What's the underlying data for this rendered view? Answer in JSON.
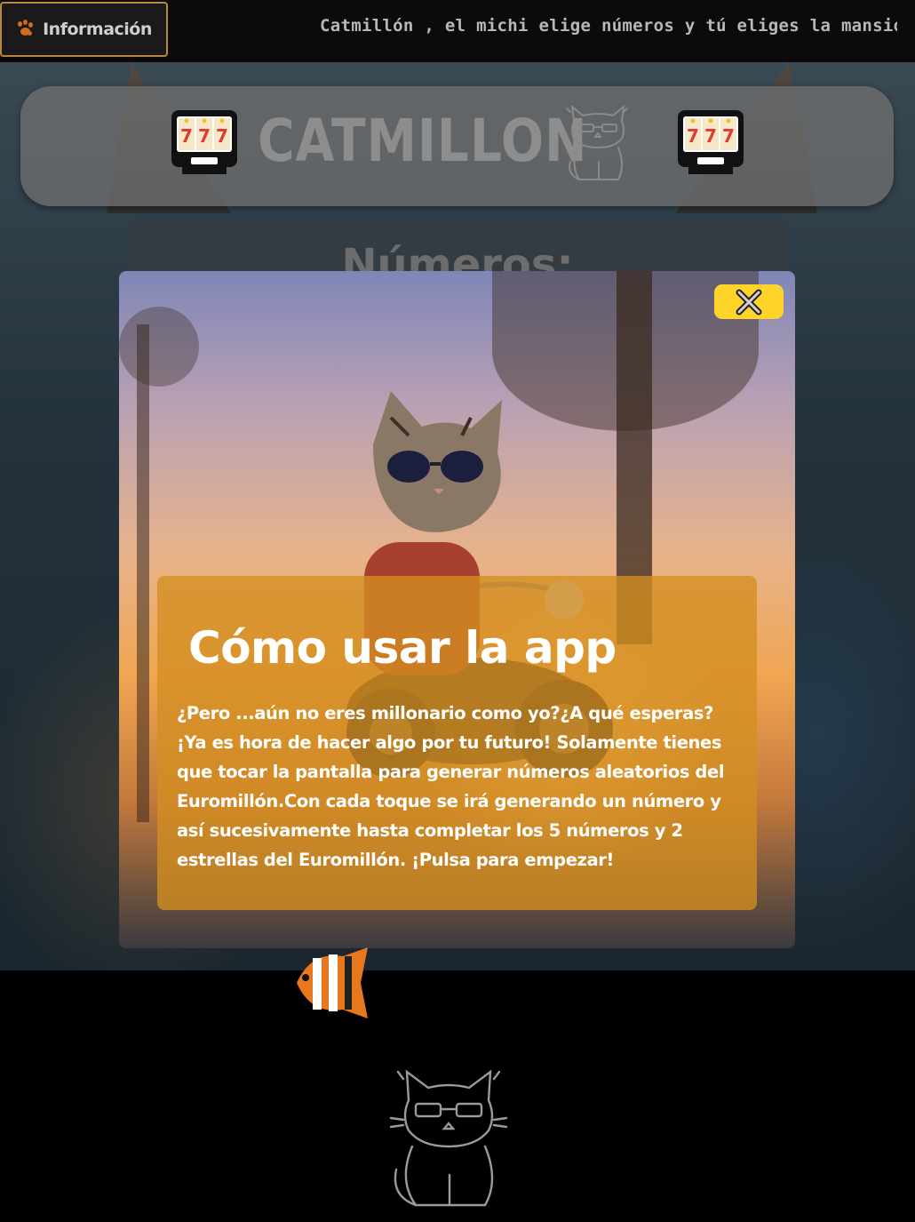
{
  "topbar": {
    "info_label": "Información",
    "marquee_text": "Catmillón , el michi elige números y tú eliges la mansión..."
  },
  "header": {
    "brand": "CATMILLON",
    "slot_digits": "777"
  },
  "numbers_panel": {
    "title": "Números:"
  },
  "modal": {
    "close_label": "×",
    "title": "Cómo usar la app",
    "body": "¿Pero ...aún no eres millonario como yo?¿A qué esperas? ¡Ya es hora de hacer algo por tu futuro! Solamente tienes que tocar la pantalla para generar números aleatorios del Euromillón.Con cada toque se irá generando un número y así sucesivamente hasta completar los 5 números y 2 estrellas del Euromillón. ¡Pulsa para empezar!"
  },
  "colors": {
    "accent_gold": "#ffd42a",
    "card_orange": "#d48e20",
    "button_border": "#b8893c",
    "paw": "#d06a1e"
  },
  "icons": [
    "paw-icon",
    "slot-machine-icon",
    "cat-sunglasses-icon",
    "close-icon",
    "fish-icon"
  ]
}
